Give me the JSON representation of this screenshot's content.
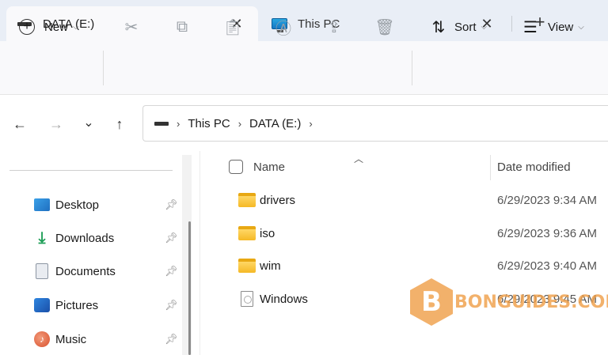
{
  "tabs": [
    {
      "label": "DATA (E:)",
      "icon": "drive-icon",
      "active": true
    },
    {
      "label": "This PC",
      "icon": "computer-icon",
      "active": false
    }
  ],
  "tab_close_glyph": "✕",
  "new_tab_glyph": "+",
  "toolbar": {
    "new_label": "New",
    "sort_label": "Sort",
    "view_label": "View",
    "disabled_actions": [
      "cut",
      "copy",
      "paste",
      "rename",
      "share",
      "delete"
    ]
  },
  "nav": {
    "back": "←",
    "forward": "→",
    "recent": "⌄",
    "up": "↑"
  },
  "breadcrumb": [
    "This PC",
    "DATA (E:)"
  ],
  "crumb_sep": "›",
  "sidebar": {
    "items": [
      {
        "label": "Desktop",
        "icon": "desktop-icon"
      },
      {
        "label": "Downloads",
        "icon": "downloads-icon"
      },
      {
        "label": "Documents",
        "icon": "documents-icon"
      },
      {
        "label": "Pictures",
        "icon": "pictures-icon"
      },
      {
        "label": "Music",
        "icon": "music-icon"
      }
    ]
  },
  "columns": {
    "name": "Name",
    "date_modified": "Date modified"
  },
  "files": [
    {
      "name": "drivers",
      "date": "6/29/2023 9:34 AM",
      "type": "folder"
    },
    {
      "name": "iso",
      "date": "6/29/2023 9:36 AM",
      "type": "folder"
    },
    {
      "name": "wim",
      "date": "6/29/2023 9:40 AM",
      "type": "folder"
    },
    {
      "name": "Windows",
      "date": "6/29/2023 9:45 AM",
      "type": "file"
    }
  ],
  "watermark": {
    "letter": "B",
    "text": "BONGUIDES.COM"
  },
  "colors": {
    "accent": "#f0a04b",
    "tabbar": "#e9eef6",
    "folder": "#f5b926"
  }
}
